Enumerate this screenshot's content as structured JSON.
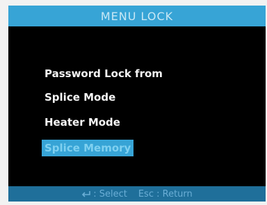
{
  "title": "MENU LOCK",
  "menu": {
    "items": [
      {
        "label": "Password Lock from"
      },
      {
        "label": "Splice Mode"
      },
      {
        "label": "Heater Mode"
      },
      {
        "label": "Splice Memory"
      }
    ],
    "selected_index": 3
  },
  "status_bar": {
    "select_icon": "enter-key-icon",
    "select_label": ": Select",
    "return_label": "Esc : Return"
  },
  "colors": {
    "screen_background": "#000000",
    "title_bar": "#37a4d6",
    "selection_highlight": "#37a4d6",
    "status_bar": "#1f6f9a",
    "menu_text": "#f5f5f5"
  }
}
